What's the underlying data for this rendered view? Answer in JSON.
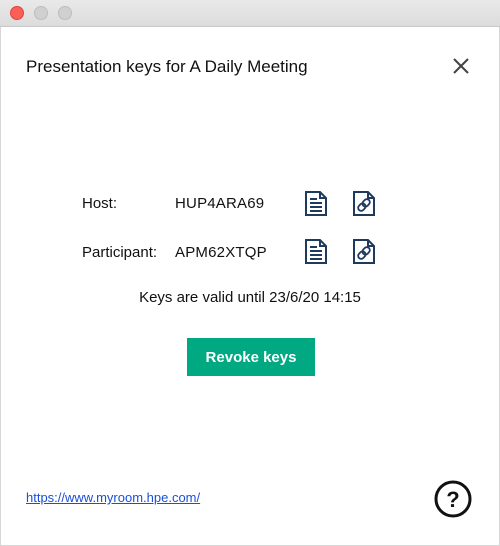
{
  "dialog": {
    "title": "Presentation keys for A Daily Meeting"
  },
  "keys": {
    "host_label": "Host:",
    "host_key": "HUP4ARA69",
    "participant_label": "Participant:",
    "participant_key": "APM62XTQP"
  },
  "validity_text": "Keys are valid until 23/6/20 14:15",
  "revoke_label": "Revoke keys",
  "footer": {
    "link": "https://www.myroom.hpe.com/"
  },
  "colors": {
    "accent": "#01a982",
    "icon": "#1e3a5f",
    "link": "#1a4fd6"
  },
  "icons": [
    "close-icon",
    "copy-document-icon",
    "copy-link-icon",
    "help-icon"
  ]
}
